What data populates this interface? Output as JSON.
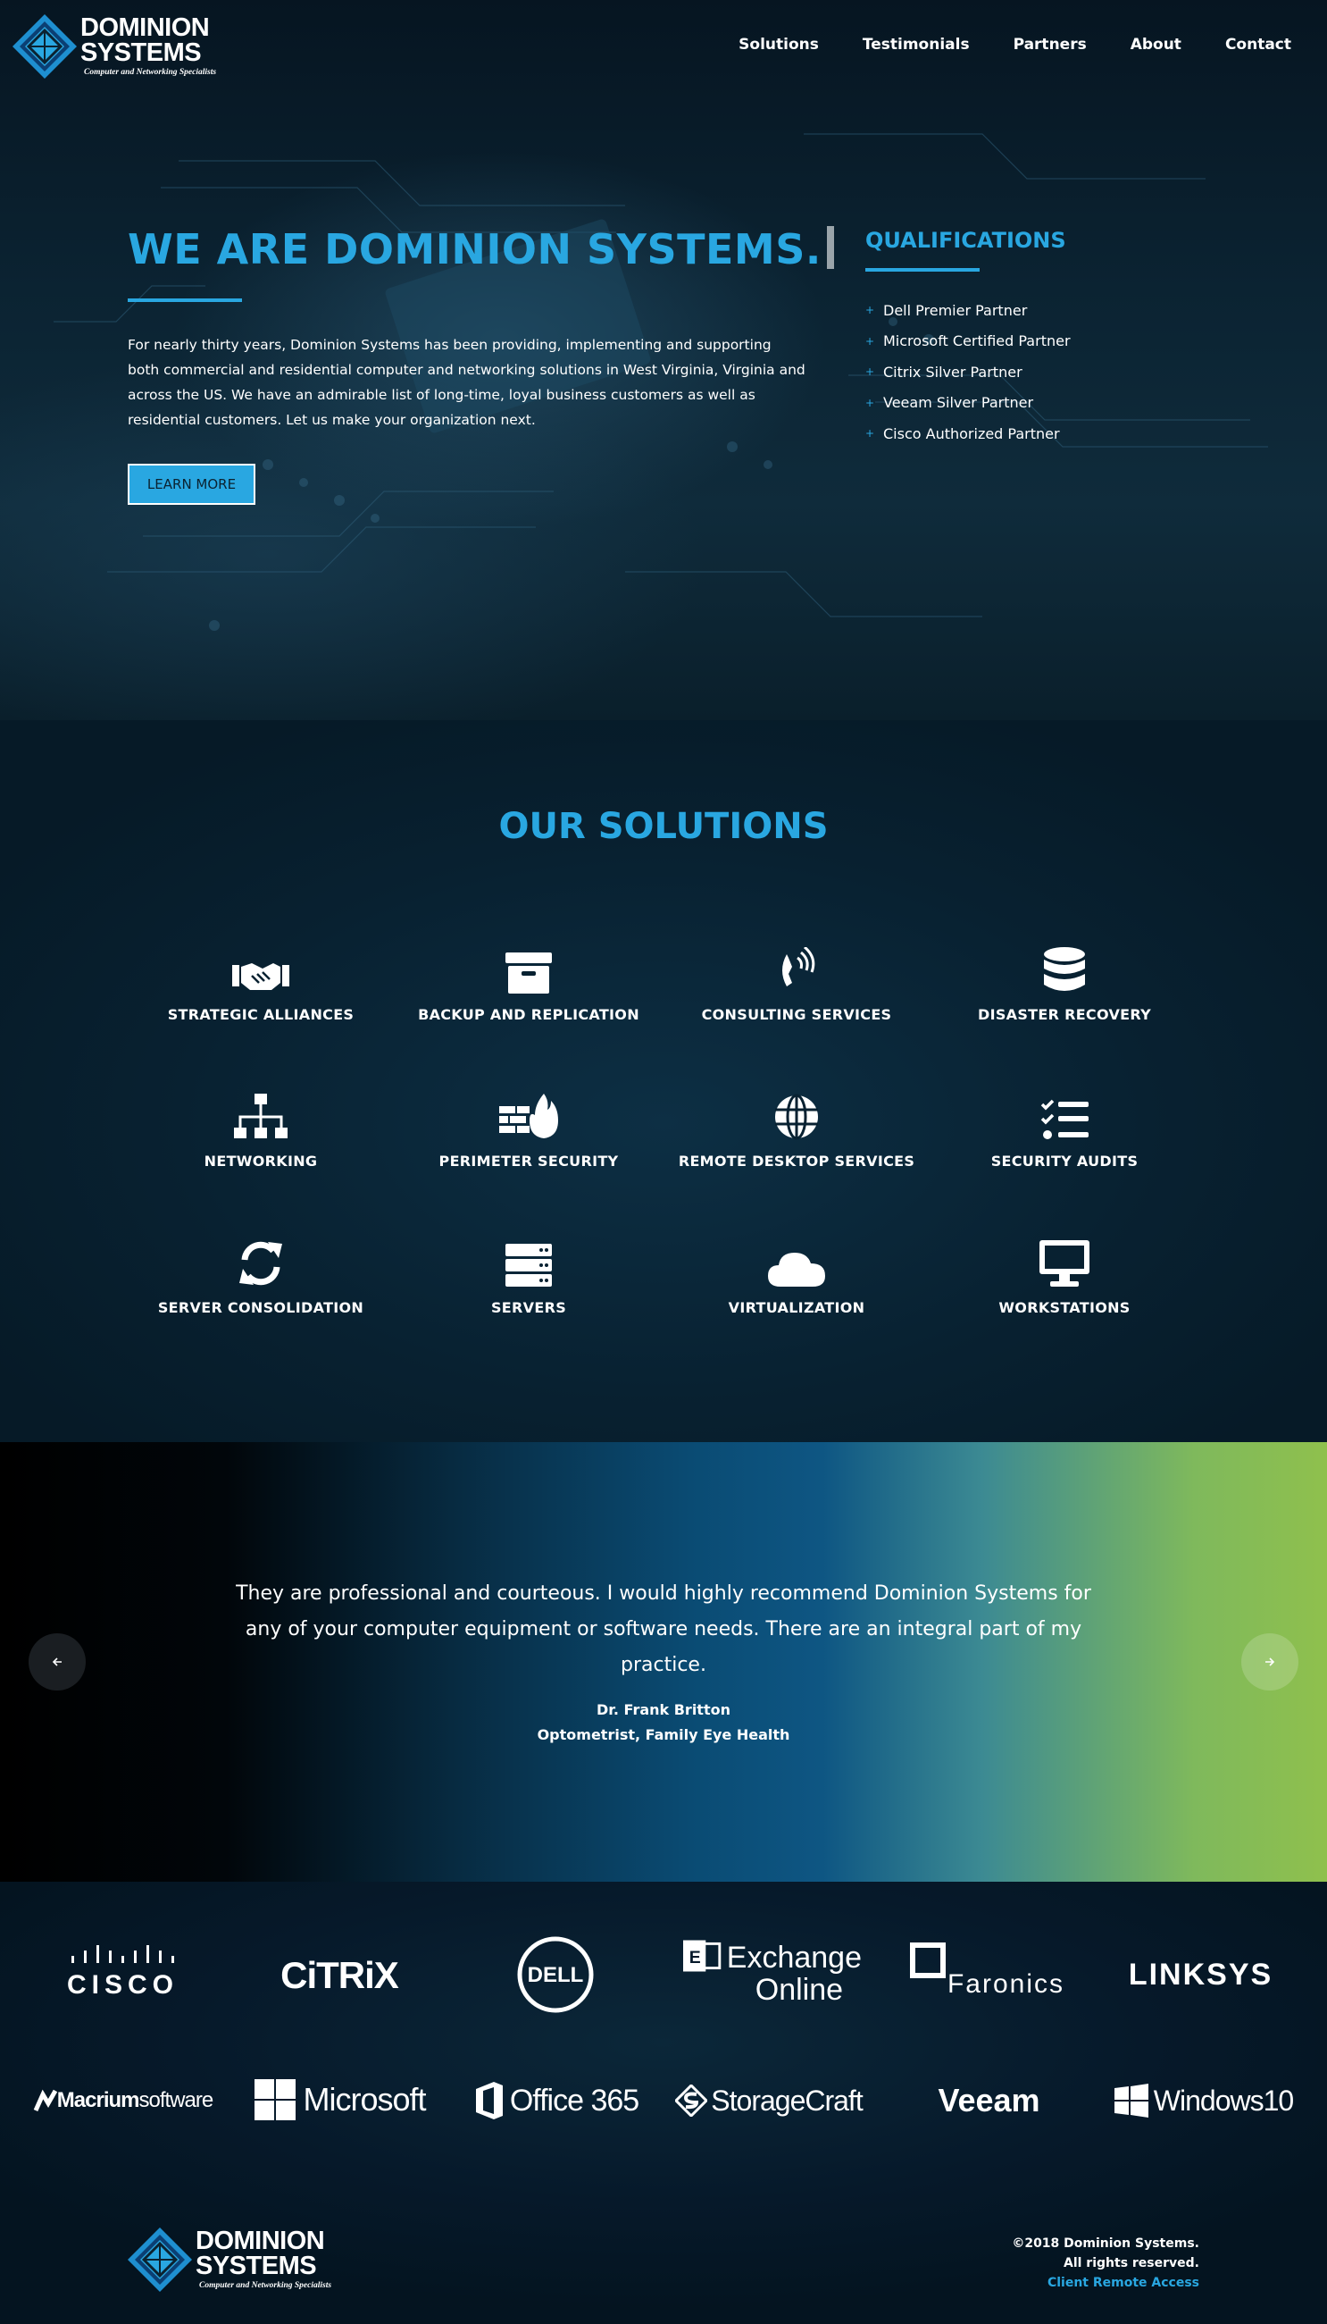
{
  "brand": {
    "name_line1": "DOMINION",
    "name_line2": "SYSTEMS",
    "tagline": "Computer and Networking Specialists",
    "accent_color": "#29a7e1"
  },
  "nav": {
    "items": [
      "Solutions",
      "Testimonials",
      "Partners",
      "About",
      "Contact"
    ]
  },
  "hero": {
    "title": "WE ARE DOMINION SYSTEMS.",
    "text": "For nearly thirty years, Dominion Systems has been providing, implementing and supporting both commercial and residential computer and networking solutions in West Virginia, Virginia and across the US. We have an admirable list of long-time, loyal business customers as well as residential customers. Let us make your organization next.",
    "button": "LEARN MORE",
    "qualifications_title": "QUALIFICATIONS",
    "qualifications": [
      "Dell Premier Partner",
      "Microsoft Certified Partner",
      "Citrix Silver Partner",
      "Veeam Silver Partner",
      "Cisco Authorized Partner"
    ]
  },
  "solutions": {
    "title": "OUR SOLUTIONS",
    "items": [
      {
        "label": "STRATEGIC ALLIANCES",
        "icon": "handshake-icon"
      },
      {
        "label": "BACKUP AND REPLICATION",
        "icon": "archive-box-icon"
      },
      {
        "label": "CONSULTING SERVICES",
        "icon": "phone-volume-icon"
      },
      {
        "label": "DISASTER RECOVERY",
        "icon": "database-icon"
      },
      {
        "label": "NETWORKING",
        "icon": "sitemap-icon"
      },
      {
        "label": "PERIMETER SECURITY",
        "icon": "firewall-icon"
      },
      {
        "label": "REMOTE DESKTOP SERVICES",
        "icon": "globe-icon"
      },
      {
        "label": "SECURITY AUDITS",
        "icon": "checklist-icon"
      },
      {
        "label": "SERVER CONSOLIDATION",
        "icon": "sync-icon"
      },
      {
        "label": "SERVERS",
        "icon": "server-icon"
      },
      {
        "label": "VIRTUALIZATION",
        "icon": "cloud-icon"
      },
      {
        "label": "WORKSTATIONS",
        "icon": "desktop-icon"
      }
    ]
  },
  "testimonial": {
    "quote": "They are professional and courteous. I would highly recommend Dominion Systems for any of your computer equipment or software needs. There are an integral part of my practice.",
    "name": "Dr. Frank Britton",
    "role": "Optometrist, Family Eye Health",
    "prev_icon": "arrow-left-icon",
    "next_icon": "arrow-right-icon"
  },
  "partners": {
    "row1": [
      "CISCO",
      "CiTRiX",
      "DELL",
      "Exchange",
      "Online",
      "Faronics",
      "LINKSYS"
    ],
    "row2": [
      "Macrium",
      "software",
      "Microsoft",
      "Office 365",
      "StorageCraft",
      "Veeam",
      "Windows10"
    ]
  },
  "footer": {
    "copyright": "©2018 Dominion Systems.",
    "rights": "All rights reserved.",
    "remote_link": "Client Remote Access"
  }
}
